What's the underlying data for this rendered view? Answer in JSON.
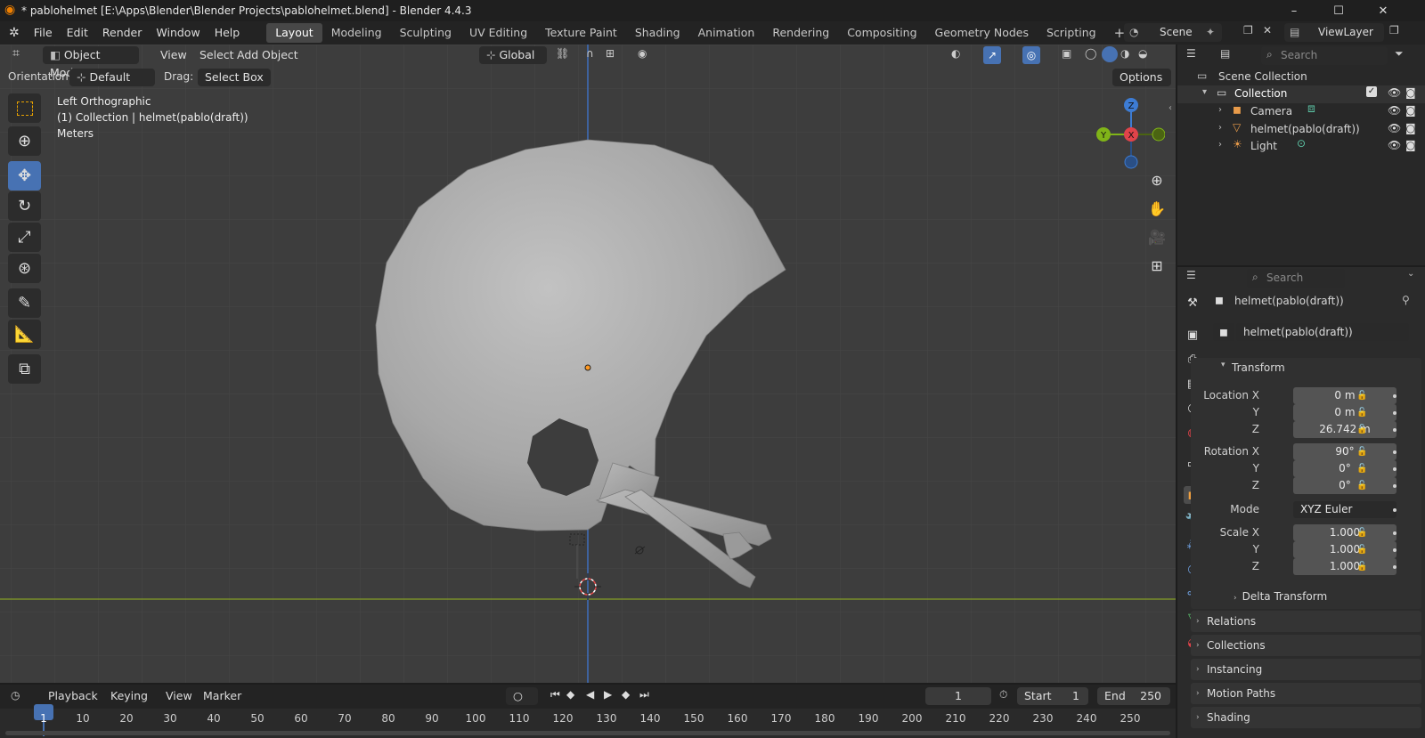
{
  "window": {
    "title": "* pablohelmet [E:\\Apps\\Blender\\Blender Projects\\pablohelmet.blend] - Blender 4.4.3",
    "controls": [
      "–",
      "☐",
      "✕"
    ]
  },
  "menu": [
    "File",
    "Edit",
    "Render",
    "Window",
    "Help"
  ],
  "workspaces": [
    "Layout",
    "Modeling",
    "Sculpting",
    "UV Editing",
    "Texture Paint",
    "Shading",
    "Animation",
    "Rendering",
    "Compositing",
    "Geometry Nodes",
    "Scripting"
  ],
  "active_workspace": "Layout",
  "scene": {
    "name": "Scene",
    "view_layer": "ViewLayer"
  },
  "viewport_header": {
    "mode": "Object Mode",
    "menus": [
      "View",
      "Select",
      "Add",
      "Object"
    ],
    "transform_orientation": "Global"
  },
  "tool_settings": {
    "orientation_label": "Orientation:",
    "orientation_value": "Default",
    "drag_label": "Drag:",
    "drag_value": "Select Box",
    "options_label": "Options"
  },
  "overlay_text": {
    "view_name": "Left Orthographic",
    "collection_info": "(1) Collection | helmet(pablo(draft))",
    "units": "Meters"
  },
  "gizmo": {
    "z": "Z",
    "y": "Y",
    "x": "X"
  },
  "outliner": {
    "search_placeholder": "Search",
    "root": "Scene Collection",
    "collection": "Collection",
    "items": [
      "Camera",
      "helmet(pablo(draft))",
      "Light"
    ]
  },
  "properties": {
    "search_placeholder": "Search",
    "object_name": "helmet(pablo(draft))",
    "datablock_name": "helmet(pablo(draft))",
    "transform": {
      "header": "Transform",
      "location_label": "Location X",
      "location": [
        "0 m",
        "0 m",
        "26.742 m"
      ],
      "rotation_label": "Rotation X",
      "rotation": [
        "90°",
        "0°",
        "0°"
      ],
      "mode_label": "Mode",
      "mode_value": "XYZ Euler",
      "scale_label": "Scale X",
      "scale": [
        "1.000",
        "1.000",
        "1.000"
      ],
      "axis_y": "Y",
      "axis_z": "Z",
      "delta": "Delta Transform"
    },
    "panels": [
      "Relations",
      "Collections",
      "Instancing",
      "Motion Paths",
      "Shading"
    ]
  },
  "timeline": {
    "menus": [
      "Playback",
      "Keying",
      "View",
      "Marker"
    ],
    "current_frame": "1",
    "start_label": "Start",
    "start_value": "1",
    "end_label": "End",
    "end_value": "250",
    "ticks": [
      "1",
      "10",
      "20",
      "30",
      "40",
      "50",
      "60",
      "70",
      "80",
      "90",
      "100",
      "110",
      "120",
      "130",
      "140",
      "150",
      "160",
      "170",
      "180",
      "190",
      "200",
      "210",
      "220",
      "230",
      "240",
      "250"
    ]
  },
  "colors": {
    "accent": "#4772b3",
    "viewport_bg": "#3d3d3d",
    "x_axis": "#e0434a",
    "y_axis": "#80b418",
    "z_axis": "#3d7cd4"
  }
}
